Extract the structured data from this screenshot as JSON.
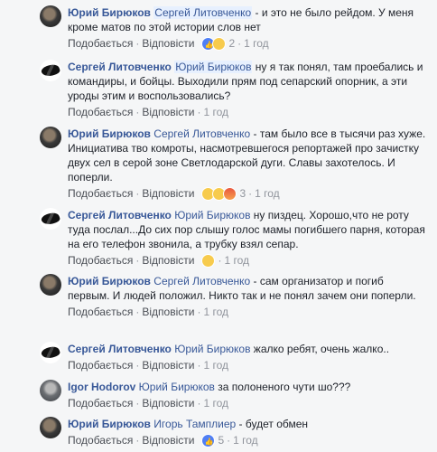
{
  "labels": {
    "like": "Подобається",
    "reply": "Відповісти"
  },
  "comments": [
    {
      "author": "Юрий Бирюков",
      "tag": "Сергей Литовченко",
      "text": " - и это не было рейдом. У меня кроме матов по этой истории слов нет",
      "reactions": [
        "like",
        "sad"
      ],
      "reaction_count": "2",
      "time": "1 год"
    },
    {
      "author": "Сергей Литовченко",
      "tag": "Юрий Бирюков",
      "text": " ну я так понял, там проебались и командиры, и бойцы. Выходили прям под сепарский опорник, а эти уроды этим и воспользовались?",
      "reactions": [],
      "reaction_count": "",
      "time": "1 год"
    },
    {
      "author": "Юрий Бирюков",
      "tag": "Сергей Литовченко",
      "text": " - там было все в тысячи раз хуже. Инициатива тво комроты, насмотревшегося репортажей про зачистку двух сел в серой зоне Светлодарской дуги. Славы захотелось. И поперли.",
      "reactions": [
        "wow",
        "sad",
        "angry"
      ],
      "reaction_count": "3",
      "time": "1 год"
    },
    {
      "author": "Сергей Литовченко",
      "tag": "Юрий Бирюков",
      "text": " ну пиздец. Хорошо,что не роту туда послал...До сих пор слышу голос мамы погибшего парня, которая на его телефон звонила, а трубку взял сепар.",
      "reactions": [
        "sad"
      ],
      "reaction_count": "",
      "time": "1 год"
    },
    {
      "author": "Юрий Бирюков",
      "tag": "Сергей Литовченко",
      "text": " - сам организатор и погиб первым. И людей положил. Никто так и не понял зачем они поперли.",
      "reactions": [],
      "reaction_count": "",
      "time": "1 год"
    },
    {
      "author": "Сергей Литовченко",
      "tag": "Юрий Бирюков",
      "text": " жалко ребят, очень жалко..",
      "reactions": [],
      "reaction_count": "",
      "time": "1 год"
    },
    {
      "author": "Igor Hodorov",
      "tag": "Юрий Бирюков",
      "text": " за полоненого чути шо???",
      "reactions": [],
      "reaction_count": "",
      "time": "1 год"
    },
    {
      "author": "Юрий Бирюков",
      "tag": "Игорь Тамплиер",
      "text": " - будет обмен",
      "reactions": [
        "like"
      ],
      "reaction_count": "5",
      "time": "1 год"
    }
  ]
}
